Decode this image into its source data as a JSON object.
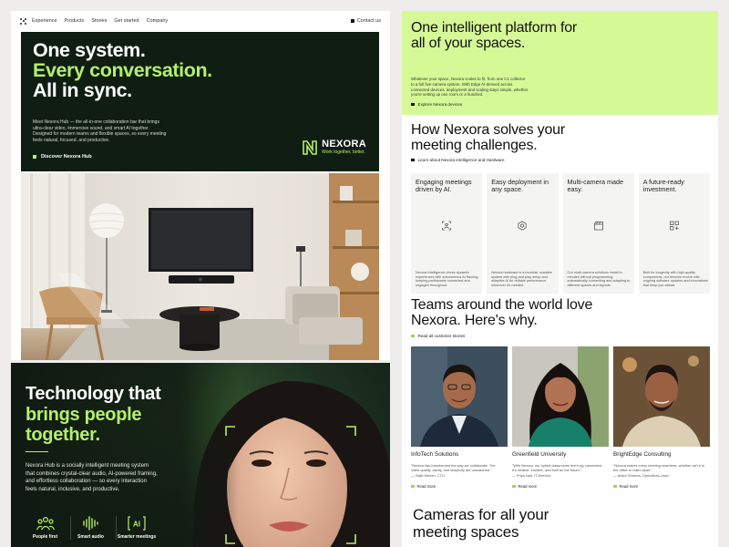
{
  "left": {
    "nav": {
      "items": [
        "Experience",
        "Products",
        "Stories",
        "Get started",
        "Company"
      ],
      "contact": "Contact us"
    },
    "hero": {
      "line1": "One system.",
      "line2": "Every conversation.",
      "line3": "All in sync.",
      "description": "Meet Nexora Hub — the all-in-one collaboration bar that brings ultra-clear video, immersive sound, and smart AI together. Designed for modern teams and flexible spaces, so every meeting feels natural, focused, and productive.",
      "cta": "Discover Nexora Hub",
      "brand_name": "NEXORA",
      "brand_tagline": "Work together, better."
    },
    "tech": {
      "line1": "Technology that",
      "line2": "brings people",
      "line3": "together.",
      "description": "Nexora Hub is a socially intelligent meeting system that combines crystal-clear audio, AI-powered framing, and effortless collaboration — so every interaction feels natural, inclusive, and productive.",
      "features": [
        {
          "label": "People first",
          "icon": "people-icon"
        },
        {
          "label": "Smart audio",
          "icon": "audio-wave-icon"
        },
        {
          "label": "Smarter meetings",
          "icon": "ai-icon"
        }
      ]
    }
  },
  "right": {
    "platform": {
      "title": "One intelligent platform for all of your spaces.",
      "description": "Whatever your space, Nexora scales to fit, from one C1 collector to a full five-camera system. With Edge AI-derived across connected devices, deployment and scaling stays simple, whether you're setting up one room or a hundred.",
      "link": "Explore Nexora devices"
    },
    "challenges": {
      "title": "How Nexora solves your meeting challenges.",
      "link": "Learn about Nexora intelligence and Hardware",
      "cards": [
        {
          "title": "Engaging meetings driven by AI.",
          "icon": "people-frame-icon",
          "text": "Nexora Intelligence drives dynamic experiences with autonomous AI framing, keeping participants connected and engaged throughout."
        },
        {
          "title": "Easy deployment in any space.",
          "icon": "gear-icon",
          "text": "Nexora hardware is a modular, scalable system with plug-and-play setup and adaptive AI for reliable performance wherever it's needed."
        },
        {
          "title": "Multi-camera made easy.",
          "icon": "camera-clapper-icon",
          "text": "Our multi-camera solutions install in minutes without programming, automatically connecting and adapting to different spaces and layouts."
        },
        {
          "title": "A future-ready investment.",
          "icon": "grid-plus-icon",
          "text": "Built for longevity with high-quality components, our devices evolve with ongoing software updates and innovations that keep you ahead."
        }
      ]
    },
    "teams": {
      "title": "Teams around the world love Nexora. Here's why.",
      "link": "Read all customer stories",
      "testimonials": [
        {
          "org": "InfoTech Solutions",
          "quote": "\"Nexora has transformed the way we collaborate. The video quality, clarity, and simplicity are unmatched.\"",
          "author": "— Rajiv Menon, CTO",
          "read": "Read more"
        },
        {
          "org": "Greenfield University",
          "quote": "\"With Nexora, our hybrid classrooms feel truly connected. It's reliable, intuitive, and built for the future.\"",
          "author": "— Priya Nair, IT Director",
          "read": "Read more"
        },
        {
          "org": "BrightEdge Consulting",
          "quote": "\"Nexora makes every meeting seamless, whether we're in the office or miles apart.\"",
          "author": "— Ankur Sharma, Operations Lead",
          "read": "Read more"
        }
      ]
    },
    "cameras": {
      "title": "Cameras for all your meeting spaces"
    }
  },
  "colors": {
    "accent_green": "#b4f06a",
    "light_green": "#d6f997",
    "dark_green": "#0f1d13",
    "background": "#eeedeb"
  }
}
